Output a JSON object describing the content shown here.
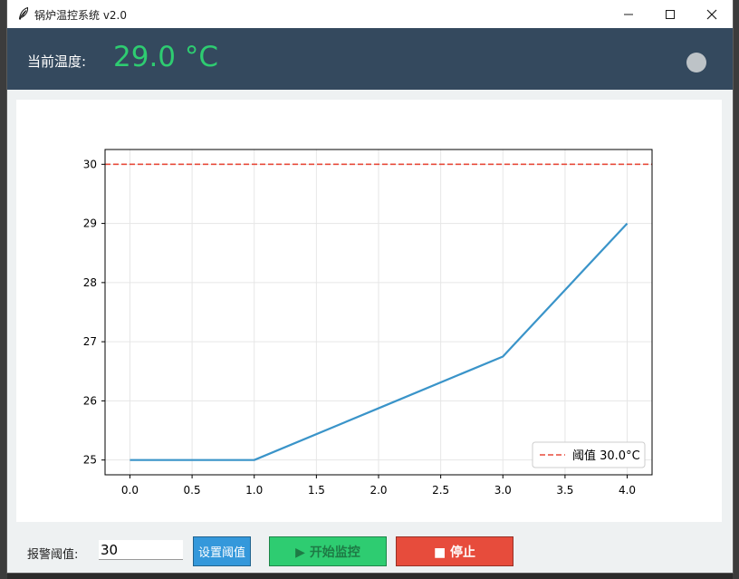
{
  "window": {
    "title": "锅炉温控系统 v2.0"
  },
  "header": {
    "temp_label": "当前温度:",
    "temp_value": "29.0 °C",
    "temp_color": "#2ecc71",
    "header_bg": "#34495e",
    "status_indicator_color": "#bdc3c7"
  },
  "controls": {
    "threshold_label": "报警阈值:",
    "threshold_value": "30",
    "set_button": "设置阈值",
    "start_button": "▶ 开始监控",
    "stop_button": "■ 停止"
  },
  "chart_data": {
    "type": "line",
    "x": [
      0.0,
      1.0,
      2.0,
      3.0,
      4.0
    ],
    "series": [
      {
        "values": [
          25.0,
          25.0,
          25.875,
          26.75,
          29.0
        ],
        "color": "#3a94c9"
      }
    ],
    "threshold": {
      "value": 30.0,
      "label": "阈值 30.0°C",
      "color": "#e74c3c",
      "style": "dashed"
    },
    "x_ticks": [
      "0.0",
      "0.5",
      "1.0",
      "1.5",
      "2.0",
      "2.5",
      "3.0",
      "3.5",
      "4.0"
    ],
    "y_ticks": [
      "25",
      "26",
      "27",
      "28",
      "29",
      "30"
    ],
    "xlim": [
      -0.2,
      4.2
    ],
    "ylim": [
      24.75,
      30.25
    ],
    "grid": true,
    "legend_position": "bottom-right"
  }
}
